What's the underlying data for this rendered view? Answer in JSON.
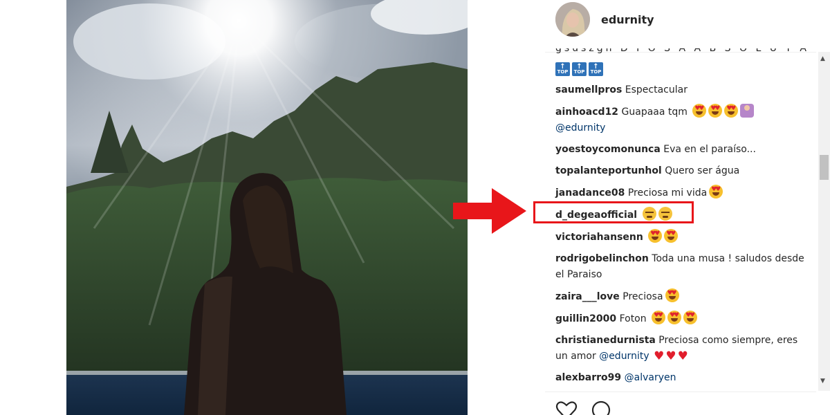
{
  "post": {
    "username": "edurnity"
  },
  "comments_top_cut": {
    "text": "gsuszgn D I O S A A B S O L U T A",
    "badges": [
      "TOP",
      "TOP",
      "TOP"
    ]
  },
  "comments": [
    {
      "user": "saumellpros",
      "text": "Espectacular"
    },
    {
      "user": "ainhoacd12",
      "text": "Guapaaa tqm",
      "mention": "@edurnity"
    },
    {
      "user": "yoestoycomonunca",
      "text": "Eva en el paraíso..."
    },
    {
      "user": "topalanteportunhol",
      "text": "Quero ser água"
    },
    {
      "user": "janadance08",
      "text": "Preciosa mi vida"
    },
    {
      "user": "d_degeaofficial",
      "text": ""
    },
    {
      "user": "victoriahansenn",
      "text": ""
    },
    {
      "user": "rodrigobelinchon",
      "text": "Toda una musa ! saludos desde el Paraiso"
    },
    {
      "user": "zaira___love",
      "text": "Preciosa"
    },
    {
      "user": "guillin2000",
      "text": "Foton"
    },
    {
      "user": "christianedurnista",
      "text": "Preciosa como siempre, eres un amor",
      "mention": "@edurnity"
    },
    {
      "user": "alexbarro99",
      "text": "",
      "mention": "@alvaryen"
    }
  ],
  "colors": {
    "highlight": "#e8161a",
    "arrow": "#e8161a",
    "mention": "#003569",
    "heart": "#e11e2c"
  },
  "icons": [
    "like-heart-icon",
    "comment-bubble-icon",
    "scroll-up-icon",
    "scroll-down-icon"
  ]
}
